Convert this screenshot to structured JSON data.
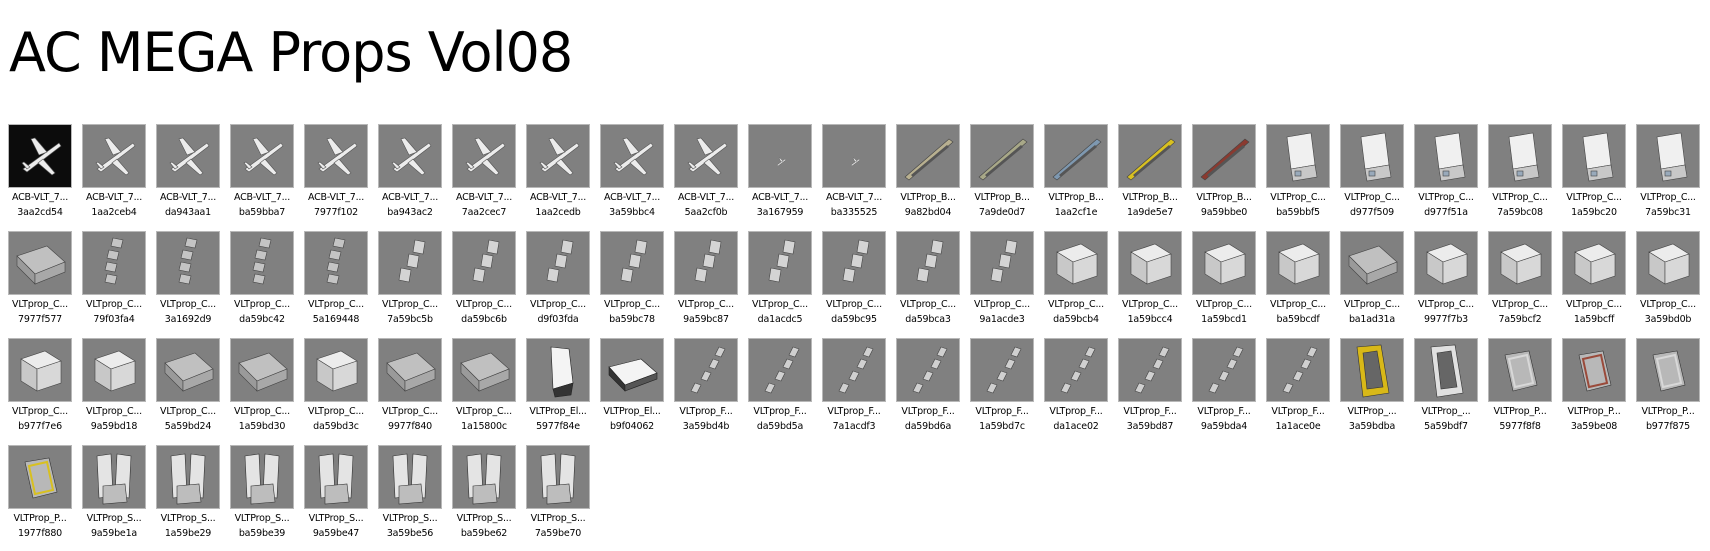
{
  "title": "AC MEGA Props Vol08",
  "rows": [
    [
      {
        "name": "ACB-VLT_7...",
        "hash": "3aa2cd54",
        "icon": "airplane-icon",
        "style": "dark"
      },
      {
        "name": "ACB-VLT_7...",
        "hash": "1aa2ceb4",
        "icon": "airplane-icon"
      },
      {
        "name": "ACB-VLT_7...",
        "hash": "da943aa1",
        "icon": "airplane-icon"
      },
      {
        "name": "ACB-VLT_7...",
        "hash": "ba59bba7",
        "icon": "airplane-icon"
      },
      {
        "name": "ACB-VLT_7...",
        "hash": "7977f102",
        "icon": "airplane-icon"
      },
      {
        "name": "ACB-VLT_7...",
        "hash": "ba943ac2",
        "icon": "airplane-icon"
      },
      {
        "name": "ACB-VLT_7...",
        "hash": "7aa2cec7",
        "icon": "airplane-icon"
      },
      {
        "name": "ACB-VLT_7...",
        "hash": "1aa2cedb",
        "icon": "airplane-icon"
      },
      {
        "name": "ACB-VLT_7...",
        "hash": "3a59bbc4",
        "icon": "airplane-icon"
      },
      {
        "name": "ACB-VLT_7...",
        "hash": "5aa2cf0b",
        "icon": "airplane-icon"
      },
      {
        "name": "ACB-VLT_7...",
        "hash": "3a167959",
        "icon": "small-airplane-icon"
      },
      {
        "name": "ACB-VLT_7...",
        "hash": "ba335525",
        "icon": "small-airplane-icon"
      },
      {
        "name": "VLTProp_B...",
        "hash": "9a82bd04",
        "icon": "belt-loader-icon",
        "color": "#b8b090"
      },
      {
        "name": "VLTProp_B...",
        "hash": "7a9de0d7",
        "icon": "belt-loader-icon",
        "color": "#a8a888"
      },
      {
        "name": "VLTProp_B...",
        "hash": "1aa2cf1e",
        "icon": "belt-loader-icon",
        "color": "#7e98b0"
      },
      {
        "name": "VLTProp_B...",
        "hash": "1a9de5e7",
        "icon": "belt-loader-icon",
        "color": "#d8c020"
      },
      {
        "name": "VLTProp_B...",
        "hash": "9a59bbe0",
        "icon": "belt-loader-icon",
        "color": "#8a3a30"
      },
      {
        "name": "VLTProp_C...",
        "hash": "ba59bbf5",
        "icon": "catering-truck-icon"
      },
      {
        "name": "VLTProp_C...",
        "hash": "d977f509",
        "icon": "catering-truck-icon"
      },
      {
        "name": "VLTProp_C...",
        "hash": "d977f51a",
        "icon": "catering-truck-icon"
      },
      {
        "name": "VLTProp_C...",
        "hash": "7a59bc08",
        "icon": "catering-truck-icon"
      },
      {
        "name": "VLTProp_C...",
        "hash": "1a59bc20",
        "icon": "catering-truck-icon"
      },
      {
        "name": "VLTProp_C...",
        "hash": "7a59bc31",
        "icon": "catering-truck-icon"
      }
    ],
    [
      {
        "name": "VLTprop_C...",
        "hash": "7977f577",
        "icon": "cart-icon"
      },
      {
        "name": "VLTprop_C...",
        "hash": "79f03fa4",
        "icon": "cart-train-icon"
      },
      {
        "name": "VLTprop_C...",
        "hash": "3a1692d9",
        "icon": "cart-train-icon"
      },
      {
        "name": "VLTprop_C...",
        "hash": "da59bc42",
        "icon": "cart-train-icon"
      },
      {
        "name": "VLTprop_C...",
        "hash": "5a169448",
        "icon": "cart-train-icon"
      },
      {
        "name": "VLTprop_C...",
        "hash": "7a59bc5b",
        "icon": "container-train-icon"
      },
      {
        "name": "VLTprop_C...",
        "hash": "da59bc6b",
        "icon": "container-train-icon"
      },
      {
        "name": "VLTprop_C...",
        "hash": "d9f03fda",
        "icon": "container-train-icon"
      },
      {
        "name": "VLTprop_C...",
        "hash": "ba59bc78",
        "icon": "container-train-icon"
      },
      {
        "name": "VLTprop_C...",
        "hash": "9a59bc87",
        "icon": "container-train-icon"
      },
      {
        "name": "VLTprop_C...",
        "hash": "da1acdc5",
        "icon": "container-train-icon"
      },
      {
        "name": "VLTprop_C...",
        "hash": "da59bc95",
        "icon": "container-train-icon"
      },
      {
        "name": "VLTprop_C...",
        "hash": "da59bca3",
        "icon": "container-train-icon"
      },
      {
        "name": "VLTprop_C...",
        "hash": "9a1acde3",
        "icon": "container-train-icon"
      },
      {
        "name": "VLTprop_C...",
        "hash": "da59bcb4",
        "icon": "container-icon"
      },
      {
        "name": "VLTprop_C...",
        "hash": "1a59bcc4",
        "icon": "container-icon"
      },
      {
        "name": "VLTprop_C...",
        "hash": "1a59bcd1",
        "icon": "container-icon"
      },
      {
        "name": "VLTprop_C...",
        "hash": "ba59bcdf",
        "icon": "container-icon"
      },
      {
        "name": "VLTprop_C...",
        "hash": "ba1ad31a",
        "icon": "cart-icon"
      },
      {
        "name": "VLTprop_C...",
        "hash": "9977f7b3",
        "icon": "container-icon"
      },
      {
        "name": "VLTprop_C...",
        "hash": "7a59bcf2",
        "icon": "container-icon"
      },
      {
        "name": "VLTprop_C...",
        "hash": "1a59bcff",
        "icon": "container-icon"
      },
      {
        "name": "VLTprop_C...",
        "hash": "3a59bd0b",
        "icon": "container-icon"
      }
    ],
    [
      {
        "name": "VLTprop_C...",
        "hash": "b977f7e6",
        "icon": "container-icon"
      },
      {
        "name": "VLTprop_C...",
        "hash": "9a59bd18",
        "icon": "container-icon"
      },
      {
        "name": "VLTprop_C...",
        "hash": "5a59bd24",
        "icon": "cart-icon"
      },
      {
        "name": "VLTprop_C...",
        "hash": "1a59bd30",
        "icon": "cart-icon"
      },
      {
        "name": "VLTprop_C...",
        "hash": "da59bd3c",
        "icon": "container-icon"
      },
      {
        "name": "VLTprop_C...",
        "hash": "9977f840",
        "icon": "cart-icon"
      },
      {
        "name": "VLTprop_C...",
        "hash": "1a15800c",
        "icon": "cart-icon"
      },
      {
        "name": "VLTProp_El...",
        "hash": "5977f84e",
        "icon": "electric-tug-icon"
      },
      {
        "name": "VLTProp_El...",
        "hash": "b9f04062",
        "icon": "electric-cart-icon"
      },
      {
        "name": "VLTprop_F...",
        "hash": "3a59bd4b",
        "icon": "dolly-train-icon"
      },
      {
        "name": "VLTprop_F...",
        "hash": "da59bd5a",
        "icon": "dolly-train-icon"
      },
      {
        "name": "VLTprop_F...",
        "hash": "7a1acdf3",
        "icon": "dolly-train-icon"
      },
      {
        "name": "VLTprop_F...",
        "hash": "da59bd6a",
        "icon": "dolly-train-icon"
      },
      {
        "name": "VLTprop_F...",
        "hash": "1a59bd7c",
        "icon": "dolly-train-icon"
      },
      {
        "name": "VLTprop_F...",
        "hash": "da1ace02",
        "icon": "dolly-train-icon"
      },
      {
        "name": "VLTprop_F...",
        "hash": "3a59bd87",
        "icon": "dolly-train-icon"
      },
      {
        "name": "VLTprop_F...",
        "hash": "9a59bda4",
        "icon": "dolly-train-icon"
      },
      {
        "name": "VLTprop_F...",
        "hash": "1a1ace0e",
        "icon": "dolly-train-icon"
      },
      {
        "name": "VLTProp_...",
        "hash": "3a59bdba",
        "icon": "pallet-loader-icon",
        "color": "#d8b818"
      },
      {
        "name": "VLTProp_...",
        "hash": "5a59bdf7",
        "icon": "pallet-loader-icon",
        "color": "#e0e0e0"
      },
      {
        "name": "VLTProp_P...",
        "hash": "5977f8f8",
        "icon": "pallet-icon"
      },
      {
        "name": "VLTProp_P...",
        "hash": "3a59be08",
        "icon": "pallet-icon",
        "color": "#9a4a3a"
      },
      {
        "name": "VLTProp_P...",
        "hash": "b977f875",
        "icon": "pallet-icon"
      }
    ],
    [
      {
        "name": "VLTProp_P...",
        "hash": "1977f880",
        "icon": "pallet-icon",
        "color": "#d8c020"
      },
      {
        "name": "VLTProp_S...",
        "hash": "9a59be1a",
        "icon": "stairs-truck-icon"
      },
      {
        "name": "VLTProp_S...",
        "hash": "1a59be29",
        "icon": "stairs-truck-icon"
      },
      {
        "name": "VLTProp_S...",
        "hash": "ba59be39",
        "icon": "stairs-truck-icon"
      },
      {
        "name": "VLTProp_S...",
        "hash": "9a59be47",
        "icon": "stairs-truck-icon"
      },
      {
        "name": "VLTProp_S...",
        "hash": "3a59be56",
        "icon": "stairs-truck-icon"
      },
      {
        "name": "VLTProp_S...",
        "hash": "ba59be62",
        "icon": "stairs-truck-icon"
      },
      {
        "name": "VLTProp_S...",
        "hash": "7a59be70",
        "icon": "stairs-truck-icon"
      }
    ]
  ]
}
